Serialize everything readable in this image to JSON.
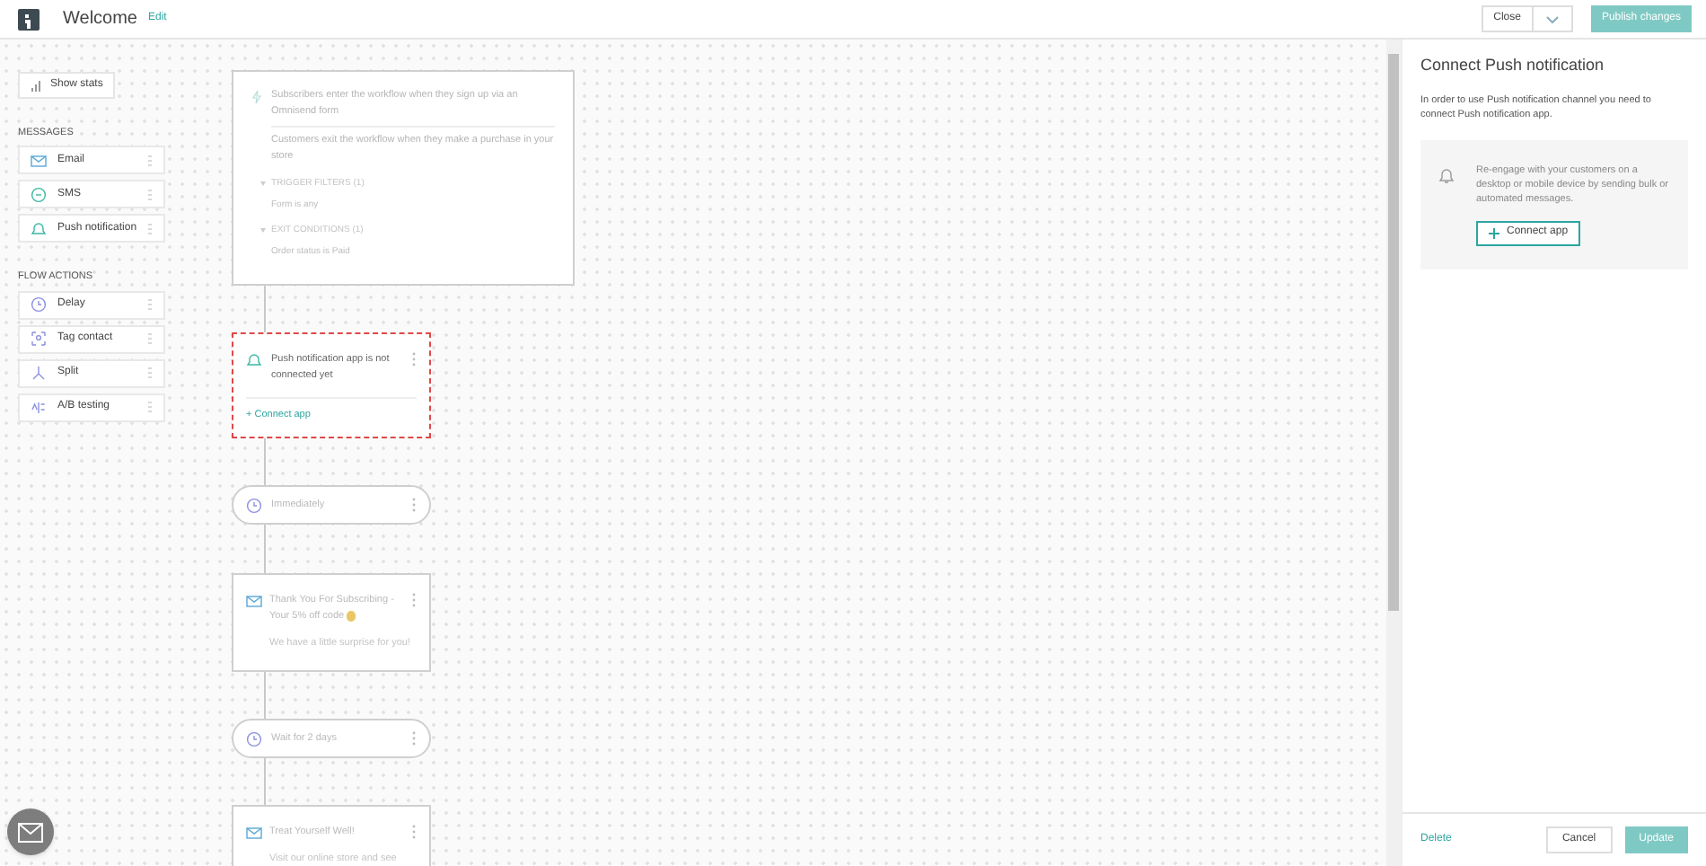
{
  "header": {
    "title": "Welcome",
    "edit_link": "Edit",
    "close_button": "Close",
    "publish_button": {
      "label": "Publish changes",
      "disabled": true
    }
  },
  "sidebar": {
    "show_stats": "Show stats",
    "sections": [
      {
        "heading": "MESSAGES",
        "items": [
          {
            "label": "Email",
            "kind": "email"
          },
          {
            "label": "SMS",
            "kind": "sms"
          },
          {
            "label": "Push notification",
            "kind": "push"
          }
        ]
      },
      {
        "heading": "FLOW ACTIONS",
        "items": [
          {
            "label": "Delay",
            "kind": "delay"
          },
          {
            "label": "Tag contact",
            "kind": "tag"
          },
          {
            "label": "Split",
            "kind": "split"
          },
          {
            "label": "A/B testing",
            "kind": "ab"
          }
        ]
      }
    ]
  },
  "flow": {
    "nodes": [
      {
        "kind": "trigger",
        "entry": "Subscribers enter the workflow when they sign up via an Omnisend form",
        "exit": "Customers exit the workflow when they make a purchase in your store",
        "filters": [
          {
            "heading": "TRIGGER FILTERS (1)",
            "value": "Form is any"
          },
          {
            "heading": "EXIT CONDITIONS (1)",
            "value": "Order status is Paid"
          }
        ]
      },
      {
        "kind": "alert",
        "text": "Push notification app is not connected yet",
        "action": "+ Connect app"
      },
      {
        "kind": "delay",
        "text": "Immediately"
      },
      {
        "kind": "email",
        "title": "Thank You For Subscribing - Your 5% off code",
        "emoji": true,
        "preview": "We have a little surprise for you!"
      },
      {
        "kind": "delay",
        "text": "Wait for 2 days"
      },
      {
        "kind": "email",
        "title": "Treat Yourself Well!",
        "emoji": false,
        "preview": "Visit our online store and see"
      }
    ]
  },
  "panel": {
    "title": "Connect Push notification",
    "description": "In order to use Push notification channel you need to connect Push notification app.",
    "info": "Re-engage with your customers on a desktop or mobile device by sending bulk or automated messages.",
    "connect_button": "Connect app",
    "delete_link": "Delete",
    "cancel_button": "Cancel",
    "update_button": {
      "label": "Update",
      "disabled": true
    }
  }
}
